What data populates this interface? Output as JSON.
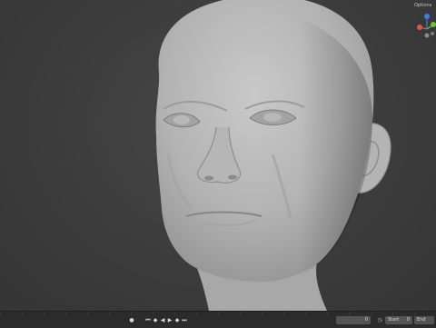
{
  "viewport": {
    "object": "sculpted-head",
    "gizmo_label": "Options",
    "gizmo_colors": {
      "x": "#e5534b",
      "y": "#6fbf40",
      "z": "#3d7fe0",
      "neutral": "#8a8a8a"
    }
  },
  "timeline": {
    "frame_current": "0",
    "start_label": "Start",
    "start_value": "0",
    "end_label": "End",
    "controls": [
      "record-icon",
      "jump-start-icon",
      "prev-keyframe-icon",
      "play-reverse-icon",
      "play-icon",
      "next-keyframe-icon",
      "jump-end-icon"
    ]
  }
}
